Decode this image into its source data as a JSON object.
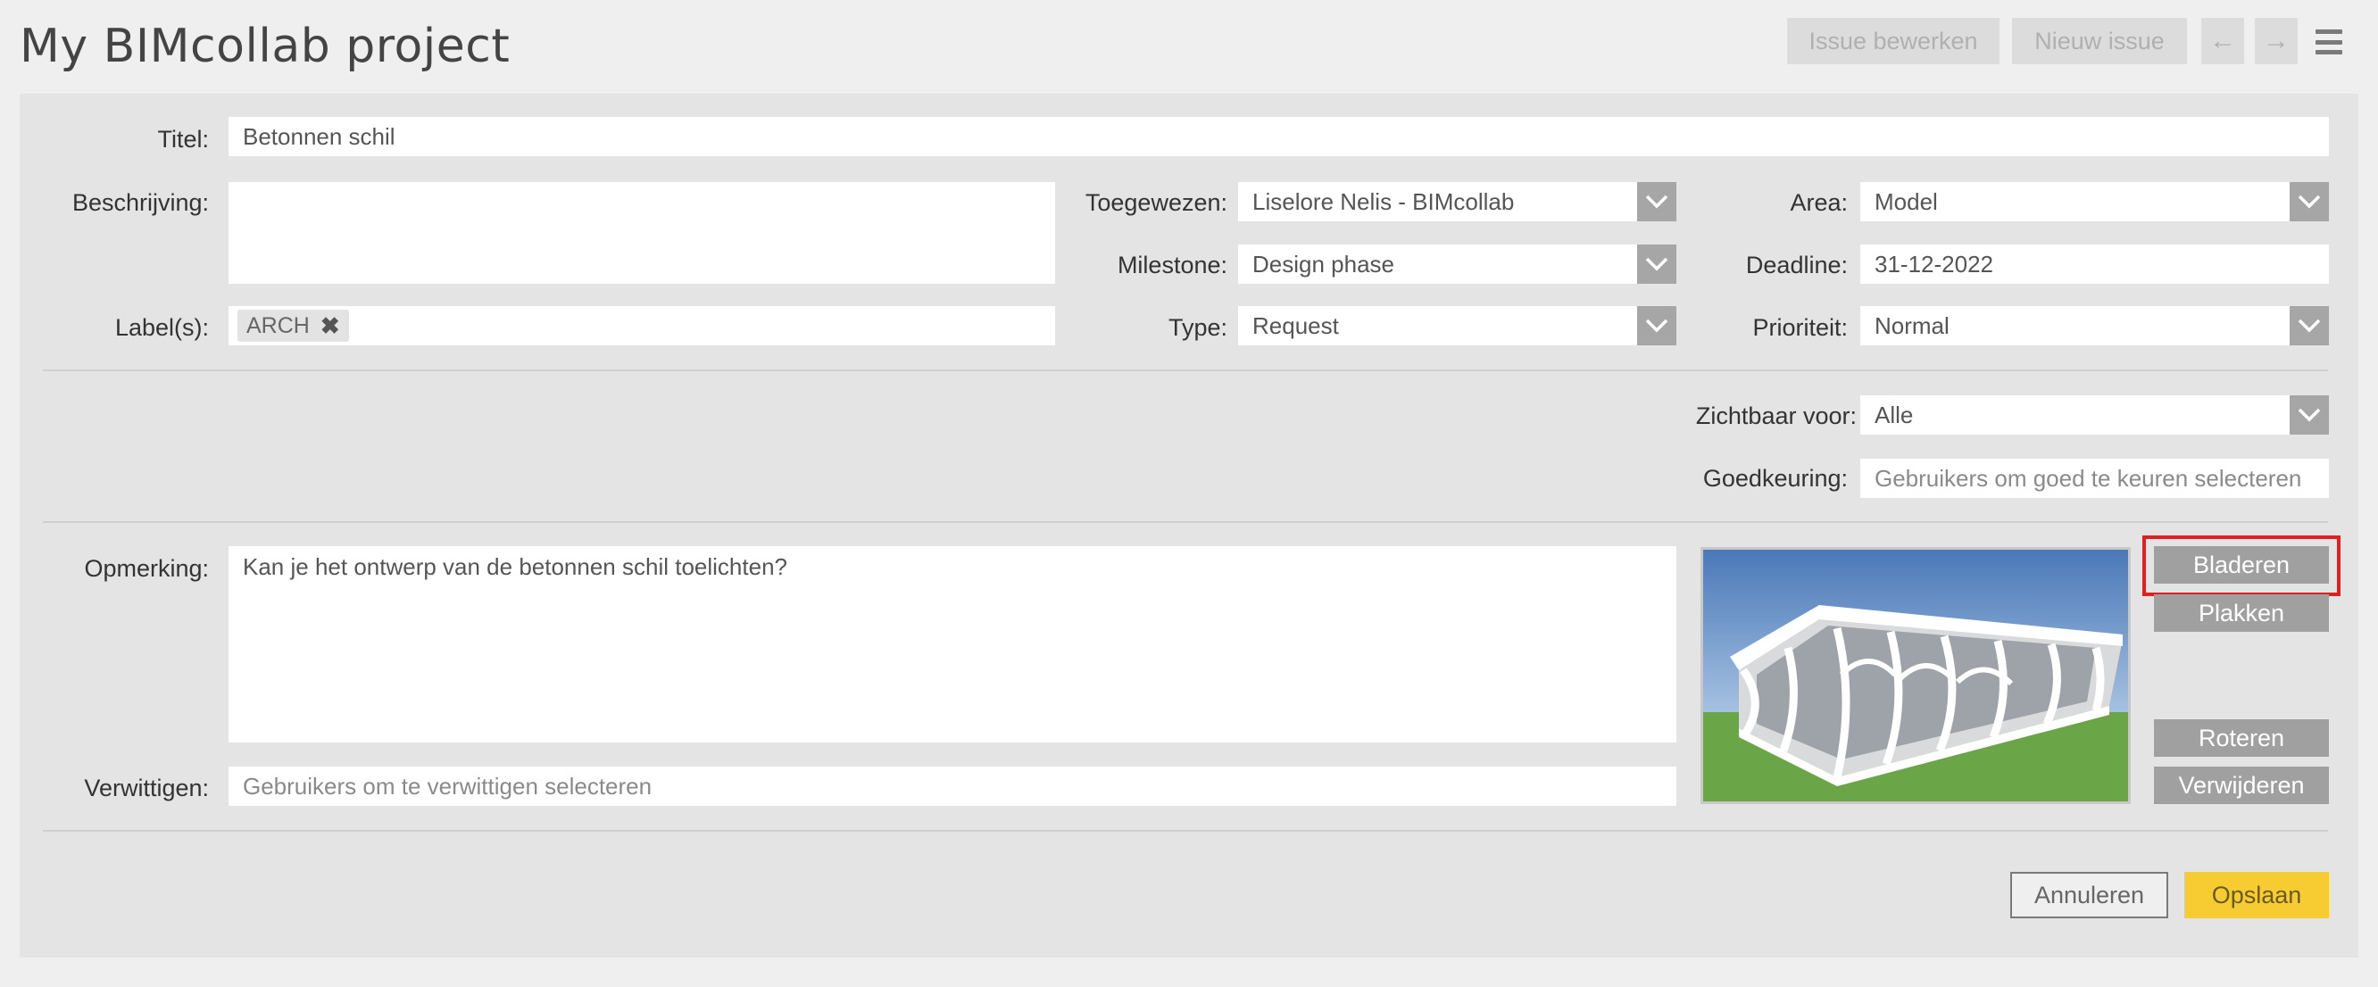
{
  "header": {
    "title": "My BIMcollab project",
    "edit_issue_label": "Issue bewerken",
    "new_issue_label": "Nieuw issue",
    "prev_arrow": "←",
    "next_arrow": "→"
  },
  "form": {
    "title": {
      "label": "Titel:",
      "value": "Betonnen schil"
    },
    "description": {
      "label": "Beschrijving:",
      "value": ""
    },
    "labels": {
      "label": "Label(s):",
      "tags": [
        "ARCH"
      ]
    },
    "assigned": {
      "label": "Toegewezen:",
      "value": "Liselore Nelis - BIMcollab"
    },
    "milestone": {
      "label": "Milestone:",
      "value": "Design phase"
    },
    "type": {
      "label": "Type:",
      "value": "Request"
    },
    "area": {
      "label": "Area:",
      "value": "Model"
    },
    "deadline": {
      "label": "Deadline:",
      "value": "31-12-2022"
    },
    "priority": {
      "label": "Prioriteit:",
      "value": "Normal"
    },
    "visible_for": {
      "label": "Zichtbaar voor:",
      "value": "Alle"
    },
    "approval": {
      "label": "Goedkeuring:",
      "placeholder": "Gebruikers om goed te keuren selecteren"
    },
    "comment": {
      "label": "Opmerking:",
      "value": "Kan je het ontwerp van de betonnen schil toelichten?"
    },
    "notify": {
      "label": "Verwittigen:",
      "placeholder": "Gebruikers om te verwittigen selecteren"
    }
  },
  "image_actions": {
    "browse_label": "Bladeren",
    "paste_label": "Plakken",
    "rotate_label": "Roteren",
    "delete_label": "Verwijderen"
  },
  "footer": {
    "cancel_label": "Annuleren",
    "save_label": "Opslaan"
  },
  "colors": {
    "accent_save": "#f7cc33",
    "highlight": "#e02020",
    "panel_bg": "#e5e4e4"
  }
}
